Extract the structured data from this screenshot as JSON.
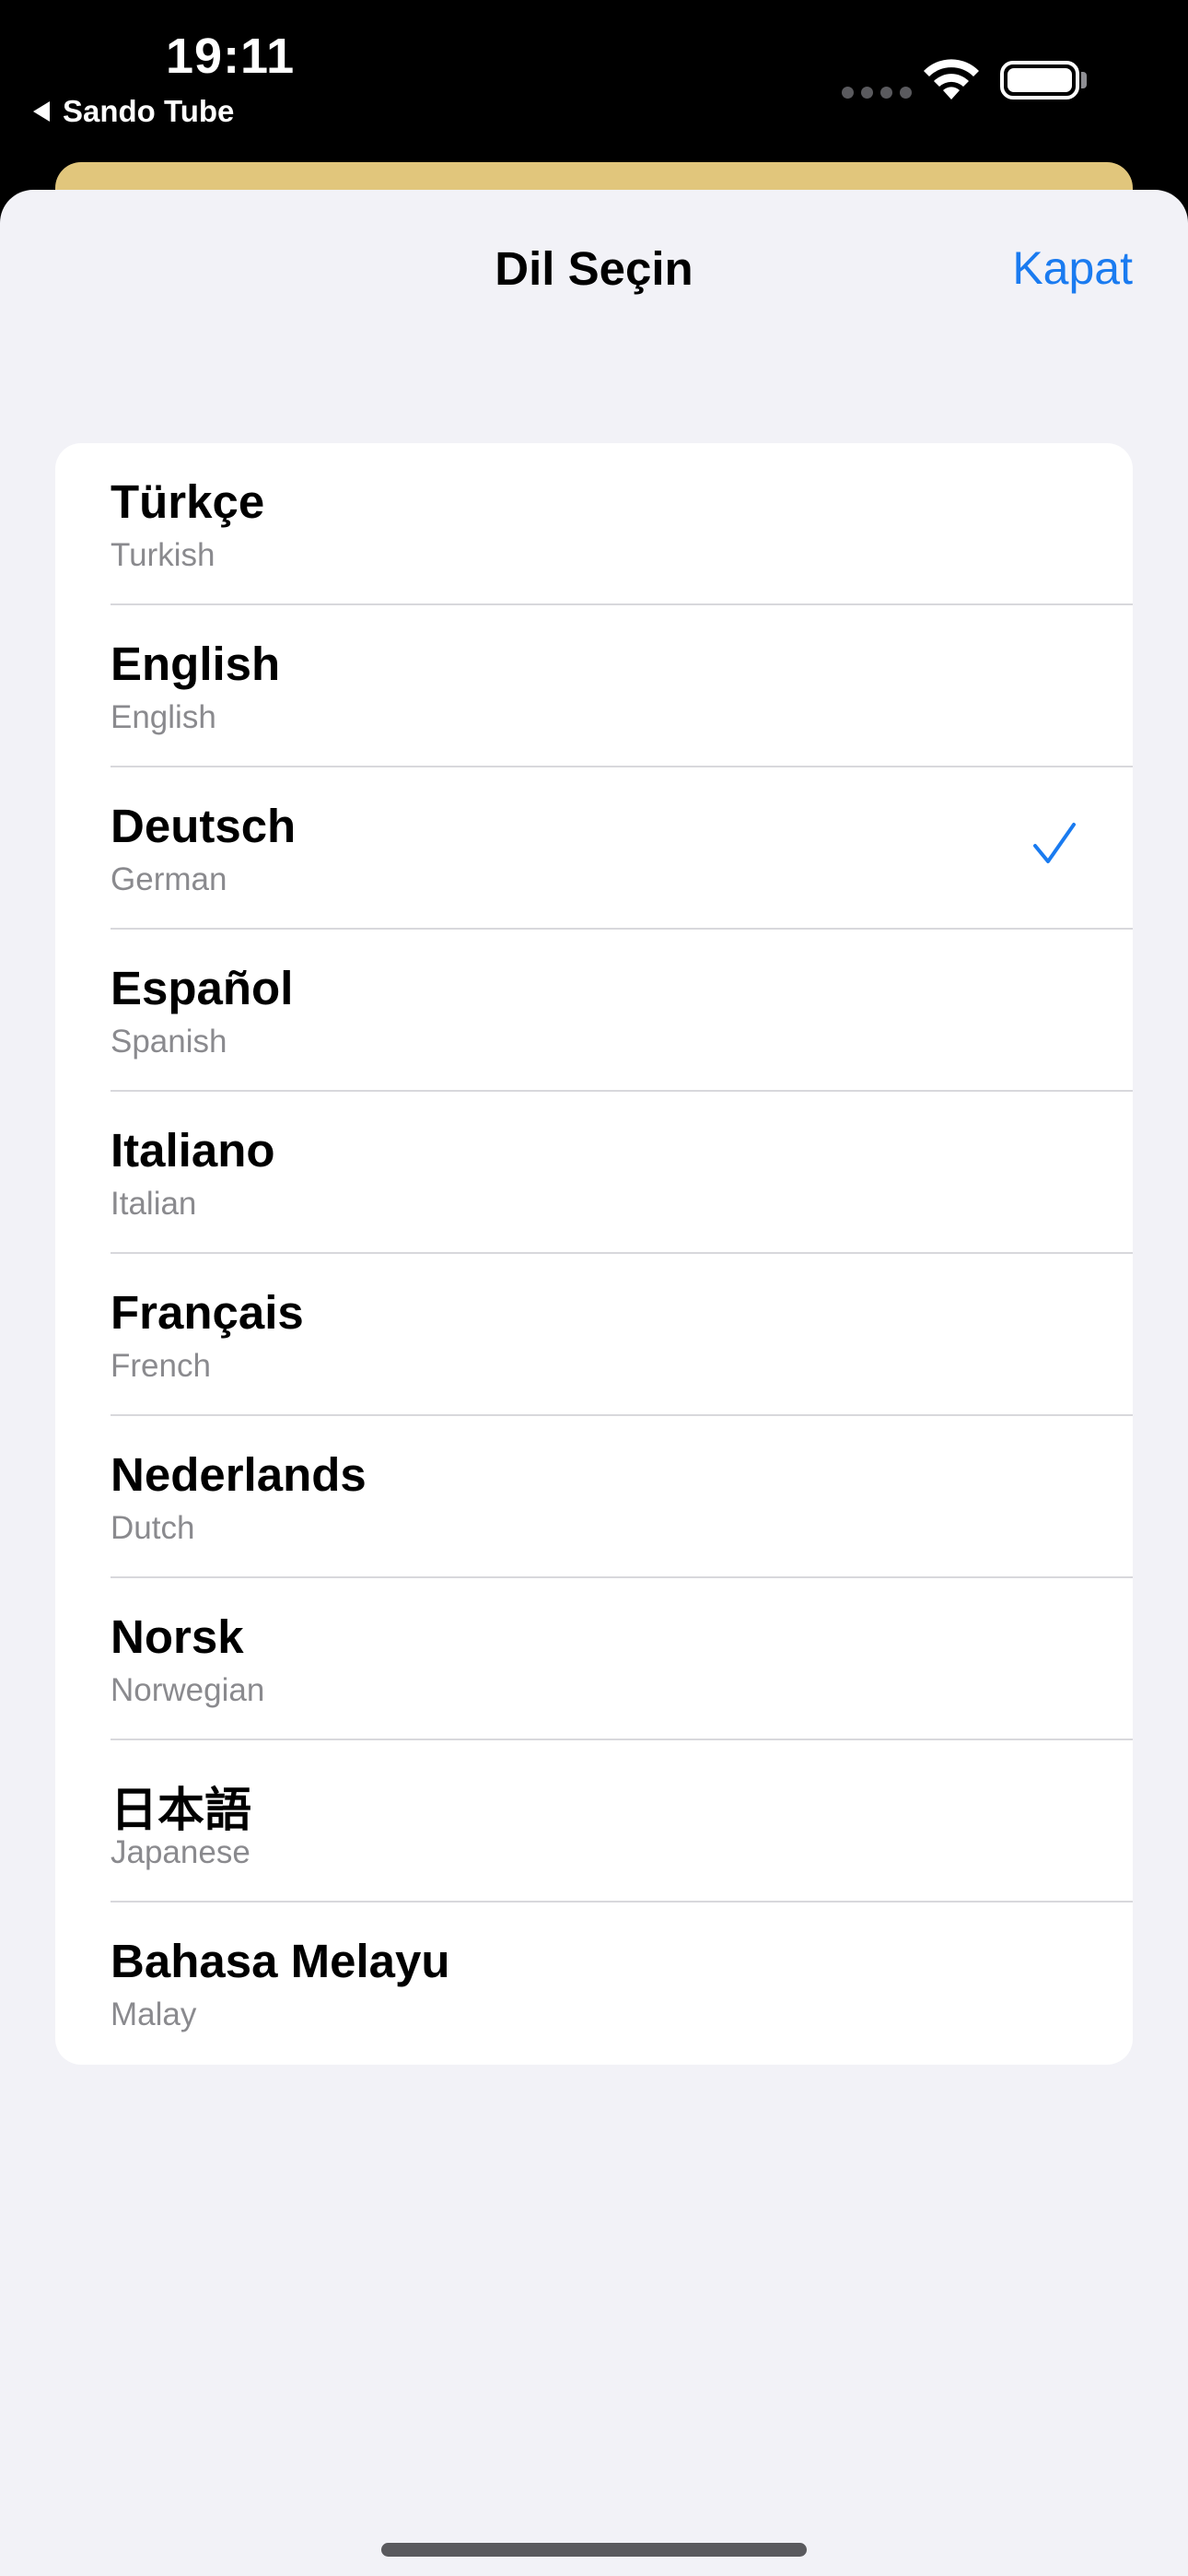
{
  "status_bar": {
    "time": "19:11",
    "back_app": "Sando Tube",
    "icons": [
      "signal-dots-icon",
      "wifi-icon",
      "battery-icon"
    ]
  },
  "sheet": {
    "title": "Dil Seçin",
    "close_label": "Kapat"
  },
  "colors": {
    "accent": "#1a7bf0",
    "sheet_background": "#f2f2f7",
    "under_sheet": "#e1c67c"
  },
  "languages": [
    {
      "native": "Türkçe",
      "english": "Turkish",
      "selected": false
    },
    {
      "native": "English",
      "english": "English",
      "selected": false
    },
    {
      "native": "Deutsch",
      "english": "German",
      "selected": true
    },
    {
      "native": "Español",
      "english": "Spanish",
      "selected": false
    },
    {
      "native": "Italiano",
      "english": "Italian",
      "selected": false
    },
    {
      "native": "Français",
      "english": "French",
      "selected": false
    },
    {
      "native": "Nederlands",
      "english": "Dutch",
      "selected": false
    },
    {
      "native": "Norsk",
      "english": "Norwegian",
      "selected": false
    },
    {
      "native": "日本語",
      "english": "Japanese",
      "selected": false
    },
    {
      "native": "Bahasa Melayu",
      "english": "Malay",
      "selected": false
    }
  ]
}
